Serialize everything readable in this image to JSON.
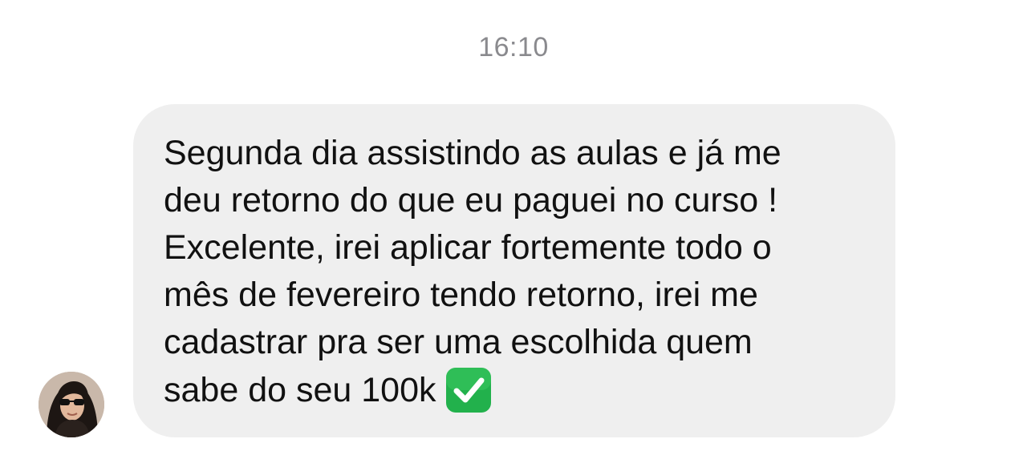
{
  "chat": {
    "timestamp": "16:10",
    "message": {
      "text": "Segunda dia assistindo as aulas e já me\ndeu retorno do que eu paguei no curso !\nExcelente, irei aplicar fortemente todo o\nmês de fevereiro tendo retorno, irei me\ncadastrar pra ser uma escolhida quem\nsabe do seu 100k",
      "emoji_icon": "check-mark-button-icon"
    },
    "colors": {
      "bubble": "#efefef",
      "timestamp": "#8a8a8e",
      "emoji_green": "#22b14c"
    }
  }
}
